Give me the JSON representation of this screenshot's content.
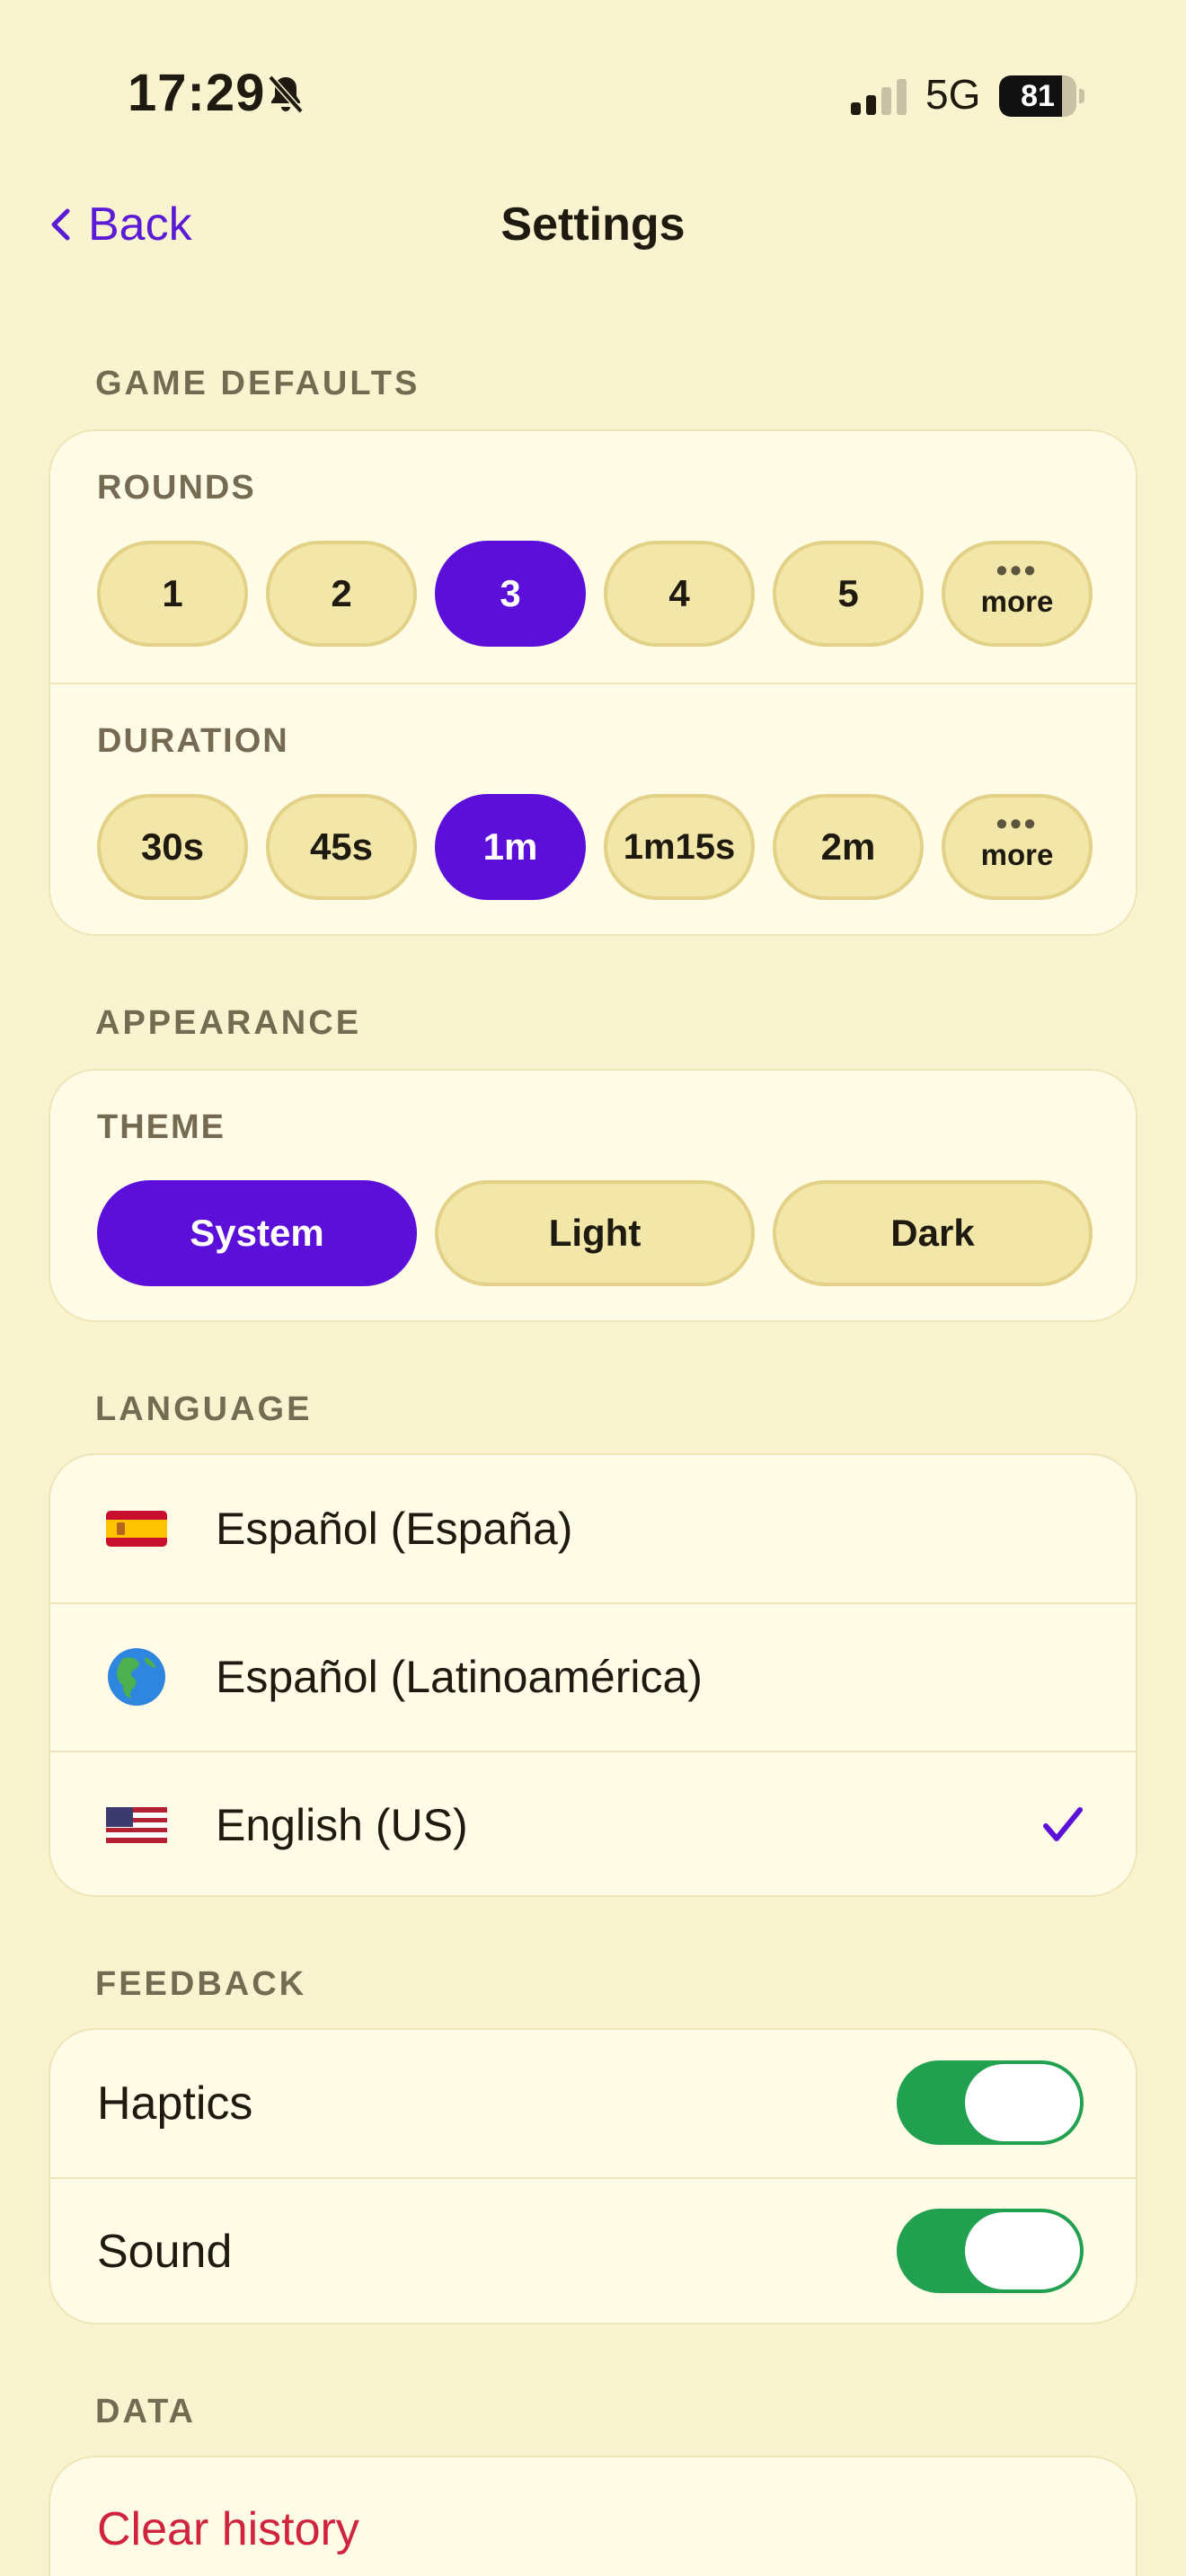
{
  "status_bar": {
    "time": "17:29",
    "network": "5G",
    "battery": "81",
    "battery_level": 0.81
  },
  "nav": {
    "back_label": "Back",
    "title": "Settings"
  },
  "game_defaults": {
    "header": "GAME DEFAULTS",
    "rounds": {
      "label": "ROUNDS",
      "options": [
        "1",
        "2",
        "3",
        "4",
        "5"
      ],
      "selected": "3",
      "more_label": "more"
    },
    "duration": {
      "label": "DURATION",
      "options": [
        "30s",
        "45s",
        "1m",
        "1m15s",
        "2m"
      ],
      "selected": "1m",
      "more_label": "more"
    }
  },
  "appearance": {
    "header": "APPEARANCE",
    "theme": {
      "label": "THEME",
      "options": [
        "System",
        "Light",
        "Dark"
      ],
      "selected": "System"
    }
  },
  "language": {
    "header": "LANGUAGE",
    "items": [
      {
        "label": "Español (España)",
        "icon": "spain-flag-icon"
      },
      {
        "label": "Español (Latinoamérica)",
        "icon": "globe-americas-icon"
      },
      {
        "label": "English (US)",
        "icon": "us-flag-icon",
        "selected": true
      }
    ]
  },
  "feedback": {
    "header": "FEEDBACK",
    "haptics": {
      "label": "Haptics",
      "on": true
    },
    "sound": {
      "label": "Sound",
      "on": true
    }
  },
  "data": {
    "header": "DATA",
    "clear_history": "Clear history"
  },
  "colors": {
    "background": "#FAF3CF",
    "accent": "#5B0FD9",
    "toggle_on": "#21A04F",
    "destructive": "#D0243E"
  }
}
